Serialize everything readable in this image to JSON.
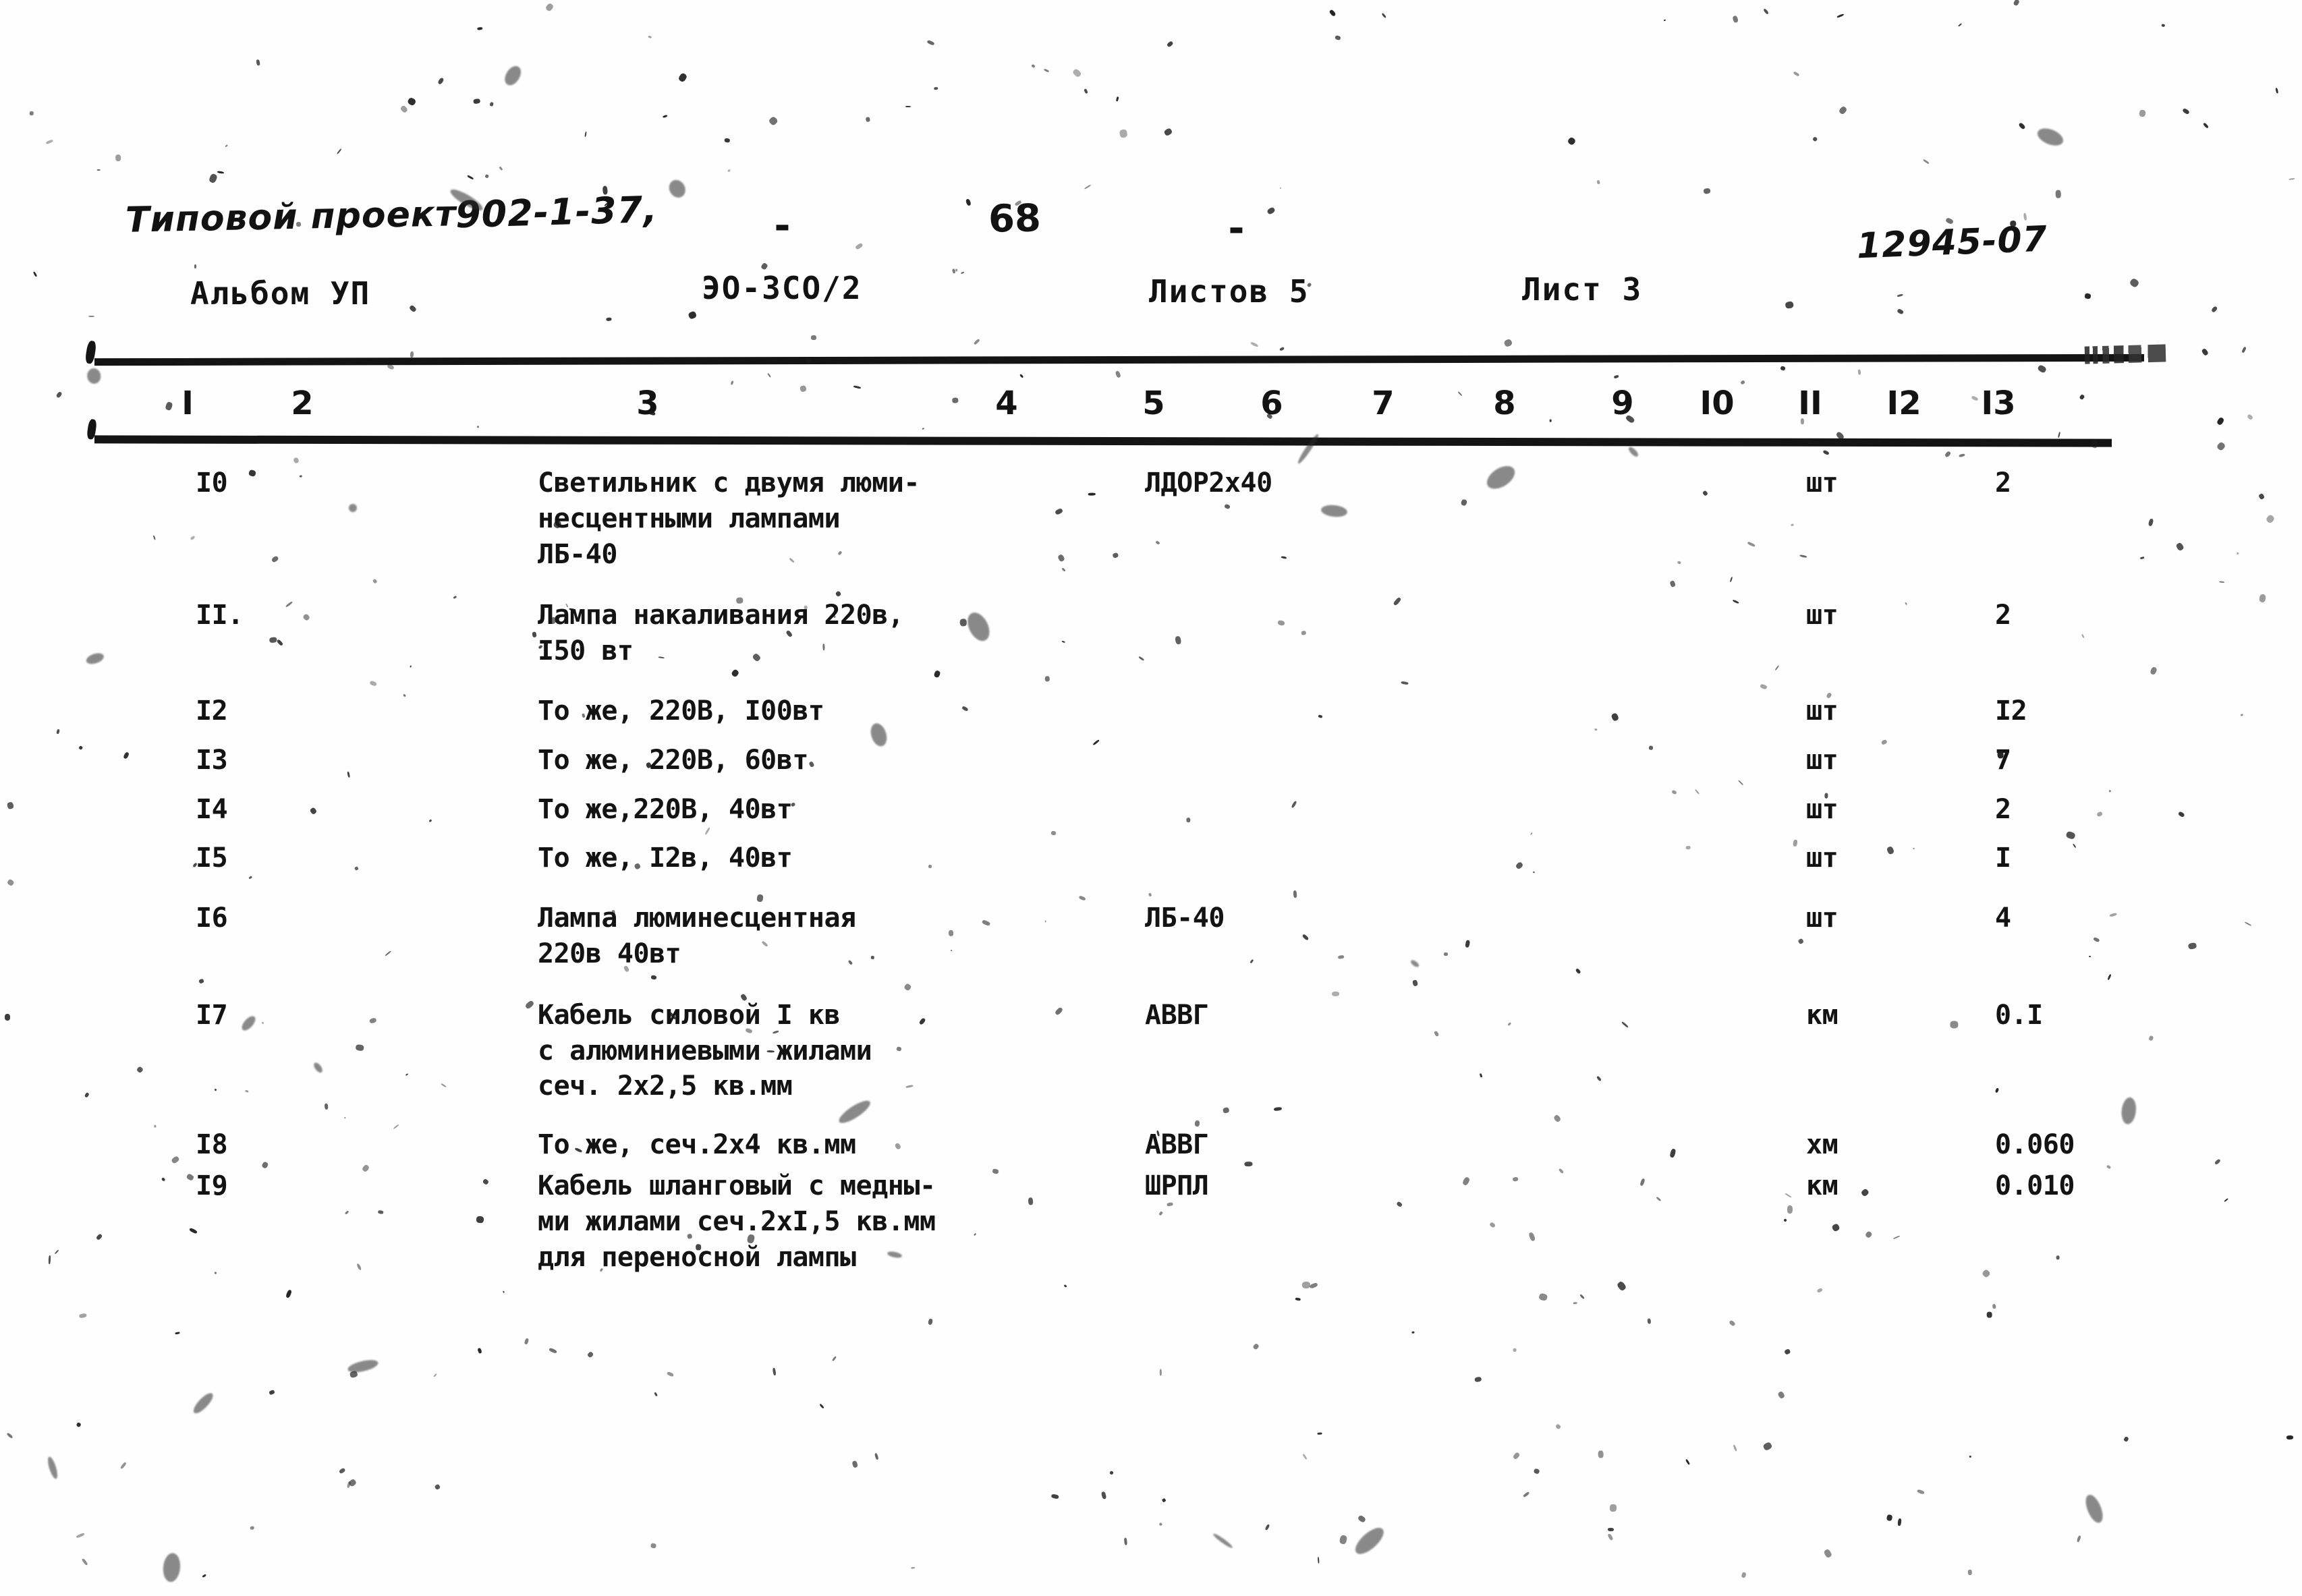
{
  "header": {
    "project_label": "Типовой проект",
    "project_code": "902-1-37,",
    "dash_left": "-",
    "page_number": "68",
    "dash_right": "-",
    "doc_code": "12945-07",
    "album_label": "Альбом УП",
    "sheet_code": "ЭО-ЗСО/2",
    "sheets_total": "Листов 5",
    "sheet_current": "Лист 3"
  },
  "table": {
    "column_numbers": [
      "I",
      "2",
      "3",
      "4",
      "5",
      "6",
      "7",
      "8",
      "9",
      "I0",
      "II",
      "I2",
      "I3"
    ],
    "rows": [
      {
        "no": "I0",
        "desc": [
          "Светильник с двумя люми-",
          "несцентными лампами",
          "ЛБ-40"
        ],
        "type": "ЛДОР2х40",
        "unit": "шт",
        "qty": "2"
      },
      {
        "no": "II.",
        "desc": [
          "Лампа накаливания 220в,",
          "I50 вт"
        ],
        "type": "",
        "unit": "шт",
        "qty": "2"
      },
      {
        "no": "I2",
        "desc": [
          "То же, 220В, I00вт"
        ],
        "type": "",
        "unit": "шт",
        "qty": "I2"
      },
      {
        "no": "I3",
        "desc": [
          "То же, 220В, 60вт"
        ],
        "type": "",
        "unit": "шт",
        "qty": "7"
      },
      {
        "no": "I4",
        "desc": [
          "То же,220В, 40вт"
        ],
        "type": "",
        "unit": "шт",
        "qty": "2"
      },
      {
        "no": "I5",
        "desc": [
          "То же, I2в, 40вт"
        ],
        "type": "",
        "unit": "шт",
        "qty": "I"
      },
      {
        "no": "I6",
        "desc": [
          "Лампа люминесцентная",
          "220в 40вт"
        ],
        "type": "ЛБ-40",
        "unit": "шт",
        "qty": "4"
      },
      {
        "no": "I7",
        "desc": [
          "Кабель силовой I кв",
          "с алюминиевыми жилами",
          "сеч. 2х2,5 кв.мм"
        ],
        "type": "АВВГ",
        "unit": "км",
        "qty": "0.I"
      },
      {
        "no": "I8",
        "desc": [
          "То же, сеч.2х4 кв.мм"
        ],
        "type": "АВВГ",
        "unit": "хм",
        "qty": "0.060"
      },
      {
        "no": "I9",
        "desc": [
          "Кабель шланговый с медны-",
          "ми жилами сеч.2хI,5 кв.мм",
          "для переносной лампы"
        ],
        "type": "ШРПЛ",
        "unit": "км",
        "qty": "0.010"
      }
    ]
  },
  "colors": {
    "ink": "#131313",
    "paper": "#fefefe"
  }
}
